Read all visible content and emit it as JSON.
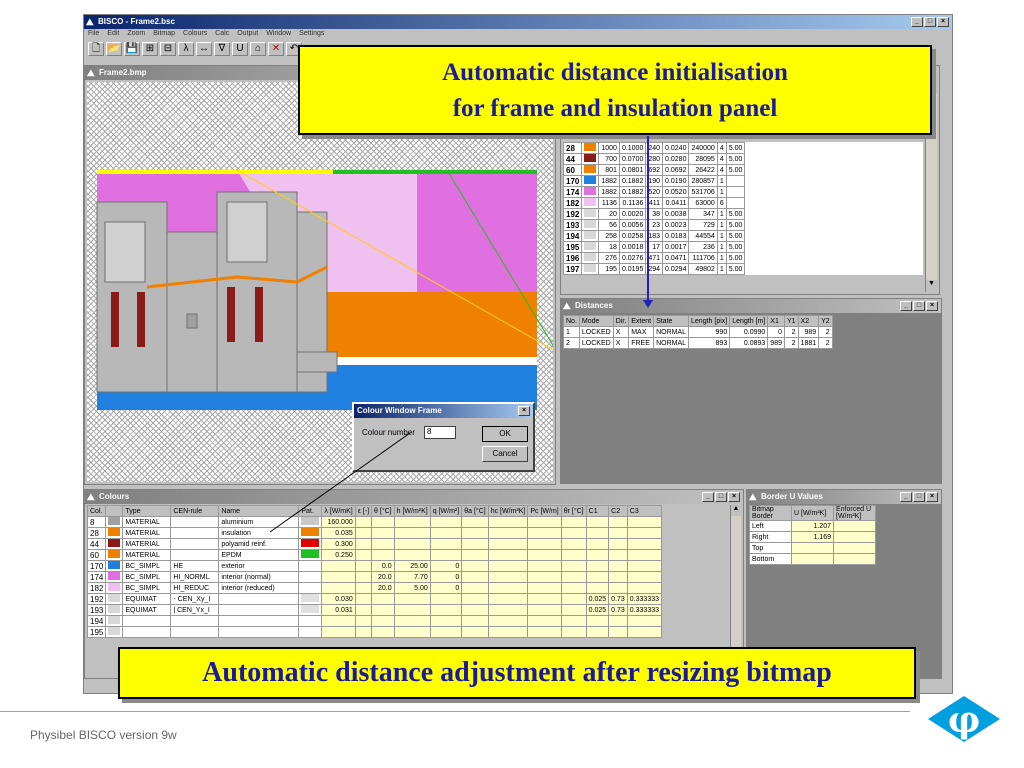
{
  "app": {
    "title": "BISCO - Frame2.bsc",
    "menu": [
      "File",
      "Edit",
      "Zoom",
      "Bitmap",
      "Colours",
      "Calc",
      "Output",
      "Window",
      "Settings"
    ],
    "window_controls": [
      "_",
      "□",
      "×"
    ],
    "toolbar_glyphs": [
      "🗋",
      "📂",
      "💾",
      "⊞",
      "⊟",
      "λ",
      "↔",
      "∇",
      "U",
      "⌂",
      "✕",
      "↶"
    ]
  },
  "bitmap_window": {
    "title": "Frame2.bmp"
  },
  "callouts": {
    "top_line1": "Automatic distance initialisation",
    "top_line2": "for frame and insulation panel",
    "bottom": "Automatic distance adjustment after resizing bitmap"
  },
  "color_table_rows": [
    {
      "col": "28",
      "color": "#f08000",
      "c1": "1000",
      "c2": "0.1000",
      "c3": "240",
      "c4": "0.0240",
      "c5": "240000",
      "c6": "4",
      "c7": "5.00"
    },
    {
      "col": "44",
      "color": "#8b1a1a",
      "c1": "700",
      "c2": "0.0700",
      "c3": "280",
      "c4": "0.0280",
      "c5": "28095",
      "c6": "4",
      "c7": "5.00"
    },
    {
      "col": "60",
      "color": "#f08000",
      "c1": "801",
      "c2": "0.0801",
      "c3": "692",
      "c4": "0.0692",
      "c5": "26422",
      "c6": "4",
      "c7": "5.00"
    },
    {
      "col": "170",
      "color": "#2080e0",
      "c1": "1882",
      "c2": "0.1882",
      "c3": "190",
      "c4": "0.0190",
      "c5": "280857",
      "c6": "1",
      "c7": ""
    },
    {
      "col": "174",
      "color": "#e070e0",
      "c1": "1882",
      "c2": "0.1882",
      "c3": "520",
      "c4": "0.0520",
      "c5": "531706",
      "c6": "1",
      "c7": ""
    },
    {
      "col": "182",
      "color": "#f0c0f0",
      "c1": "1136",
      "c2": "0.1136",
      "c3": "411",
      "c4": "0.0411",
      "c5": "63000",
      "c6": "6",
      "c7": ""
    },
    {
      "col": "192",
      "color": "#d8d8d8",
      "c1": "20",
      "c2": "0.0020",
      "c3": "38",
      "c4": "0.0038",
      "c5": "347",
      "c6": "1",
      "c7": "5.00"
    },
    {
      "col": "193",
      "color": "#d8d8d8",
      "c1": "56",
      "c2": "0.0056",
      "c3": "23",
      "c4": "0.0023",
      "c5": "729",
      "c6": "1",
      "c7": "5.00"
    },
    {
      "col": "194",
      "color": "#d8d8d8",
      "c1": "258",
      "c2": "0.0258",
      "c3": "183",
      "c4": "0.0183",
      "c5": "44554",
      "c6": "1",
      "c7": "5.00"
    },
    {
      "col": "195",
      "color": "#d8d8d8",
      "c1": "18",
      "c2": "0.0018",
      "c3": "17",
      "c4": "0.0017",
      "c5": "236",
      "c6": "1",
      "c7": "5.00"
    },
    {
      "col": "196",
      "color": "#d8d8d8",
      "c1": "276",
      "c2": "0.0276",
      "c3": "471",
      "c4": "0.0471",
      "c5": "111706",
      "c6": "1",
      "c7": "5.00"
    },
    {
      "col": "197",
      "color": "#d8d8d8",
      "c1": "195",
      "c2": "0.0195",
      "c3": "294",
      "c4": "0.0294",
      "c5": "49802",
      "c6": "1",
      "c7": "5.00"
    }
  ],
  "distances": {
    "title": "Distances",
    "headers": [
      "No.",
      "Mode",
      "Dir.",
      "Extent",
      "State",
      "Length [pix]",
      "Length [m]",
      "X1",
      "Y1",
      "X2",
      "Y2"
    ],
    "rows": [
      [
        "1",
        "LOCKED",
        "X",
        "MAX",
        "NORMAL",
        "990",
        "0.0990",
        "0",
        "2",
        "989",
        "2"
      ],
      [
        "2",
        "LOCKED",
        "X",
        "FREE",
        "NORMAL",
        "893",
        "0.0893",
        "989",
        "2",
        "1881",
        "2"
      ]
    ]
  },
  "colour_dialog": {
    "title": "Colour Window Frame",
    "label": "Colour number",
    "value": "8",
    "ok": "OK",
    "cancel": "Cancel"
  },
  "colours": {
    "title": "Colours",
    "headers": [
      "Col.",
      "",
      "Type",
      "CEN-rule",
      "Name",
      "Pat.",
      "λ [W/mK]",
      "ε [-]",
      "θ [°C]",
      "h [W/m²K]",
      "q [W/m²]",
      "θa [°C]",
      "hc [W/m²K]",
      "Pc [W/m]",
      "θr [°C]",
      "C1",
      "C2",
      "C3"
    ],
    "rows": [
      {
        "col": "8",
        "color": "#a0a0a0",
        "type": "MATERIAL",
        "cen": "",
        "name": "aluminium",
        "pat": "#c8c8c8",
        "lambda": "160.000",
        "theta": "",
        "h": "",
        "q": "",
        "c1": "",
        "c2": "",
        "c3": ""
      },
      {
        "col": "28",
        "color": "#f08000",
        "type": "MATERIAL",
        "cen": "",
        "name": "insulation",
        "pat": "#f08000",
        "lambda": "0.035",
        "theta": "",
        "h": "",
        "q": "",
        "c1": "",
        "c2": "",
        "c3": ""
      },
      {
        "col": "44",
        "color": "#8b1a1a",
        "type": "MATERIAL",
        "cen": "",
        "name": "polyamid reinf.",
        "pat": "#e00000",
        "lambda": "0.300",
        "theta": "",
        "h": "",
        "q": "",
        "c1": "",
        "c2": "",
        "c3": ""
      },
      {
        "col": "60",
        "color": "#f08000",
        "type": "MATERIAL",
        "cen": "",
        "name": "EPDM",
        "pat": "#20c020",
        "lambda": "0.250",
        "theta": "",
        "h": "",
        "q": "",
        "c1": "",
        "c2": "",
        "c3": ""
      },
      {
        "col": "170",
        "color": "#2080e0",
        "type": "BC_SIMPL",
        "cen": "HE",
        "name": "exterior",
        "pat": "",
        "lambda": "",
        "theta": "0.0",
        "h": "25.00",
        "q": "0",
        "c1": "",
        "c2": "",
        "c3": ""
      },
      {
        "col": "174",
        "color": "#e070e0",
        "type": "BC_SIMPL",
        "cen": "HI_NORML",
        "name": "interior (normal)",
        "pat": "",
        "lambda": "",
        "theta": "20.0",
        "h": "7.70",
        "q": "0",
        "c1": "",
        "c2": "",
        "c3": ""
      },
      {
        "col": "182",
        "color": "#f0c0f0",
        "type": "BC_SIMPL",
        "cen": "HI_REDUC",
        "name": "interior (reduced)",
        "pat": "",
        "lambda": "",
        "theta": "20.0",
        "h": "5.00",
        "q": "0",
        "c1": "",
        "c2": "",
        "c3": ""
      },
      {
        "col": "192",
        "color": "#d8d8d8",
        "type": "EQUIMAT",
        "cen": "- CEN_Xy_I",
        "name": "",
        "pat": "#e0e0e0",
        "lambda": "0.030",
        "theta": "",
        "h": "",
        "q": "",
        "c1": "0.025",
        "c2": "0.73",
        "c3": "0.333333"
      },
      {
        "col": "193",
        "color": "#d8d8d8",
        "type": "EQUIMAT",
        "cen": "| CEN_Yx_I",
        "name": "",
        "pat": "#e0e0e0",
        "lambda": "0.031",
        "theta": "",
        "h": "",
        "q": "",
        "c1": "0.025",
        "c2": "0.73",
        "c3": "0.333333"
      },
      {
        "col": "194",
        "color": "#d8d8d8",
        "type": "",
        "cen": "",
        "name": "",
        "pat": "",
        "lambda": "",
        "theta": "",
        "h": "",
        "q": "",
        "c1": "",
        "c2": "",
        "c3": ""
      },
      {
        "col": "195",
        "color": "#d8d8d8",
        "type": "",
        "cen": "",
        "name": "",
        "pat": "",
        "lambda": "",
        "theta": "",
        "h": "",
        "q": "",
        "c1": "",
        "c2": "",
        "c3": ""
      }
    ]
  },
  "border_u": {
    "title": "Border U Values",
    "headers": [
      "Bitmap Border",
      "U [W/m²K]",
      "Enforced U [W/m²K]"
    ],
    "rows": [
      [
        "Left",
        "1.207",
        ""
      ],
      [
        "Right",
        "1.169",
        ""
      ],
      [
        "Top",
        "",
        ""
      ],
      [
        "Bottom",
        "",
        ""
      ]
    ]
  },
  "footer": {
    "text": "Physibel BISCO version 9w",
    "logo": "φ"
  },
  "colors": {
    "callout_bg": "#ffff00",
    "callout_text": "#1a1aa0",
    "logo": "#00a0e0"
  }
}
